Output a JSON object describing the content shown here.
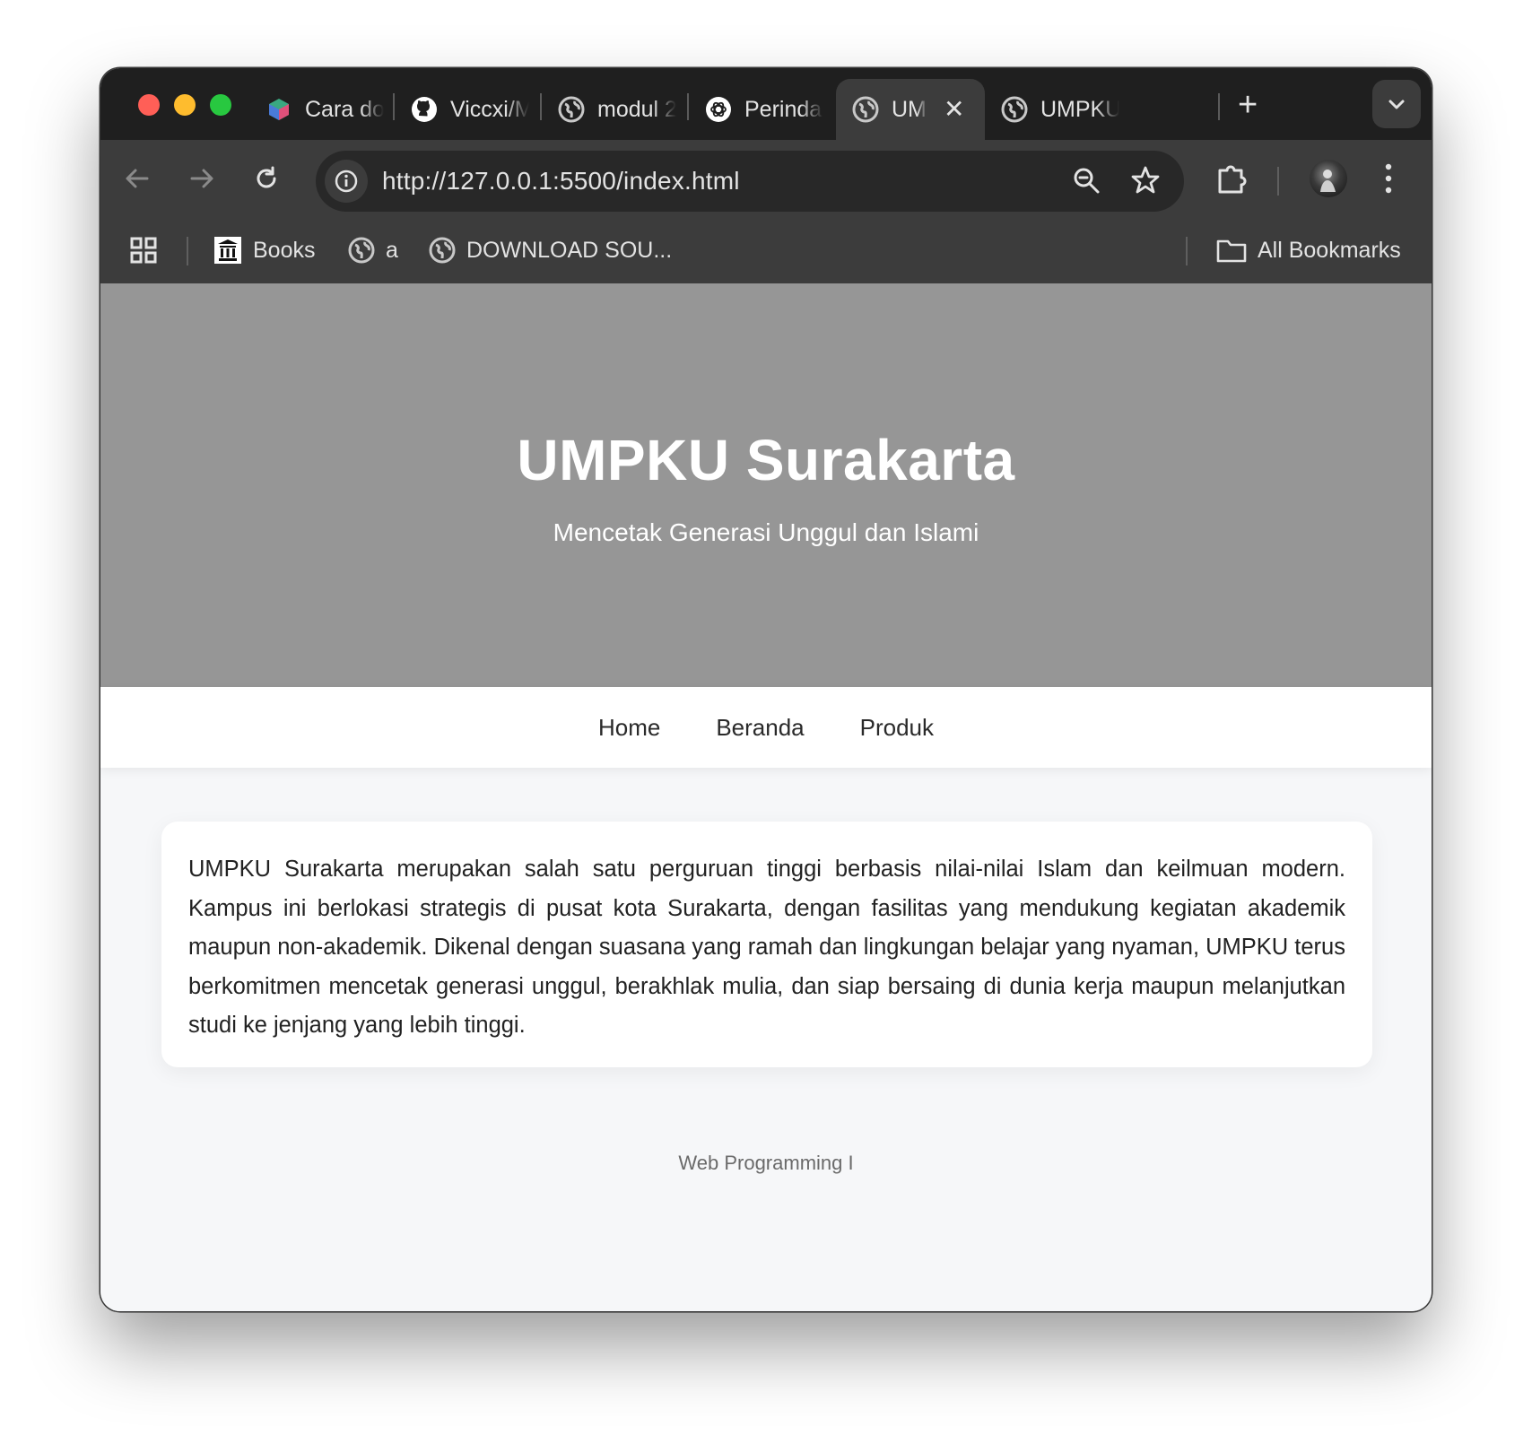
{
  "browser": {
    "tabs": [
      {
        "title": "Cara download",
        "icon": "colorful-cube-icon"
      },
      {
        "title": "Viccxi/Modul",
        "icon": "github-icon"
      },
      {
        "title": "modul 2",
        "icon": "globe-icon"
      },
      {
        "title": "Perindah",
        "icon": "openai-icon"
      },
      {
        "title": "UM",
        "icon": "globe-icon",
        "active": true
      },
      {
        "title": "UMPKU",
        "icon": "globe-icon"
      }
    ],
    "address": "http://127.0.0.1:5500/index.html",
    "bookmarks": [
      {
        "label": "Books",
        "icon": "books-icon"
      },
      {
        "label": "a",
        "icon": "globe-icon"
      },
      {
        "label": "DOWNLOAD SOU...",
        "icon": "globe-icon"
      }
    ],
    "all_bookmarks": "All Bookmarks"
  },
  "hero": {
    "title": "UMPKU Surakarta",
    "subtitle": "Mencetak Generasi Unggul dan Islami"
  },
  "nav": {
    "items": [
      "Home",
      "Beranda",
      "Produk"
    ]
  },
  "content": {
    "paragraph": "UMPKU Surakarta merupakan salah satu perguruan tinggi berbasis nilai-nilai Islam dan keilmuan modern. Kampus ini berlokasi strategis di pusat kota Surakarta, dengan fasilitas yang mendukung kegiatan akademik maupun non-akademik. Dikenal dengan suasana yang ramah dan lingkungan belajar yang nyaman, UMPKU terus berkomitmen mencetak generasi unggul, berakhlak mulia, dan siap bersaing di dunia kerja maupun melanjutkan studi ke jenjang yang lebih tinggi."
  },
  "footer": {
    "text": "Web Programming I"
  },
  "colors": {
    "hero_bg": "#969696",
    "chrome_dark": "#1f1f1f",
    "toolbar": "#3c3c3c",
    "page_bg": "#f6f7f9"
  }
}
